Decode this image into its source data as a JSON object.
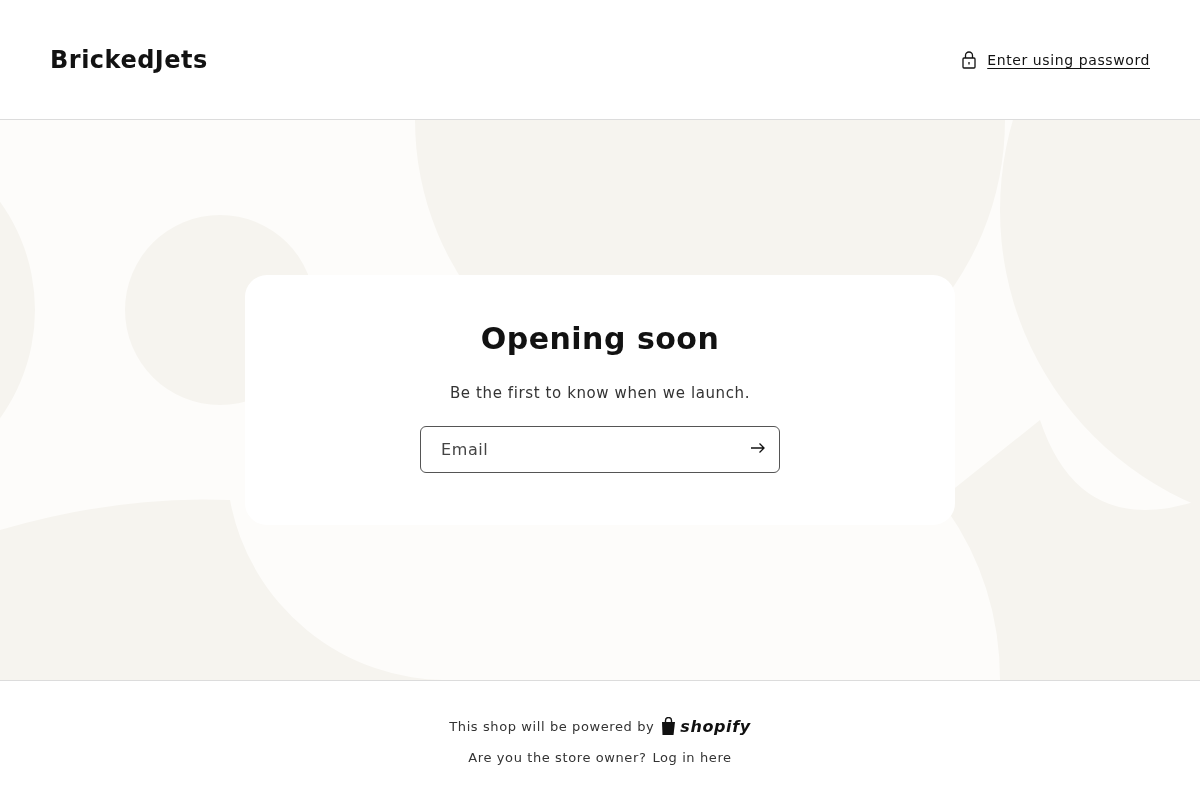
{
  "header": {
    "logo": "BrickedJets",
    "password_link": "Enter using password"
  },
  "card": {
    "title": "Opening soon",
    "subtitle": "Be the first to know when we launch.",
    "email": {
      "placeholder": "Email"
    }
  },
  "footer": {
    "powered_by": "This shop will be powered by",
    "brand": "shopify",
    "owner_question": "Are you the store owner?",
    "login_link": "Log in here"
  }
}
